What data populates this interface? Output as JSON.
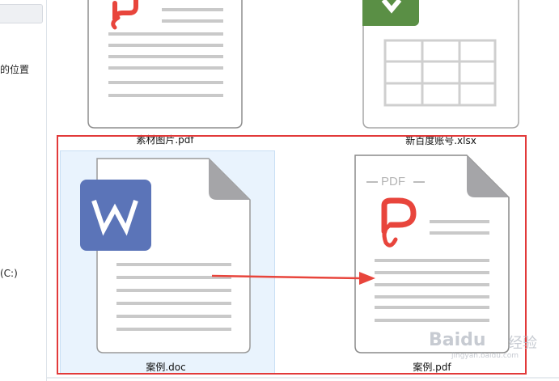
{
  "sidebar": {
    "items": [
      {
        "label": "的位置"
      },
      {
        "label": "(C:)"
      }
    ]
  },
  "files": [
    {
      "name": "素材图片.pdf",
      "type": "pdf",
      "icon": "pdf-file-icon"
    },
    {
      "name": "新百度账号.xlsx",
      "type": "xlsx",
      "icon": "excel-file-icon"
    },
    {
      "name": "案例.doc",
      "type": "doc",
      "icon": "word-file-icon",
      "selected": true
    },
    {
      "name": "案例.pdf",
      "type": "pdf",
      "icon": "pdf-file-icon",
      "badge": "PDF"
    }
  ],
  "watermark": {
    "brand": "Baidu",
    "suffix": "经验",
    "url": "jingyan.baidu.com"
  },
  "colors": {
    "pdf_red": "#e8453c",
    "word_blue": "#5b74b8",
    "excel_green": "#5a8f45",
    "highlight": "#e23a3a",
    "selection": "#e9f3fd"
  }
}
